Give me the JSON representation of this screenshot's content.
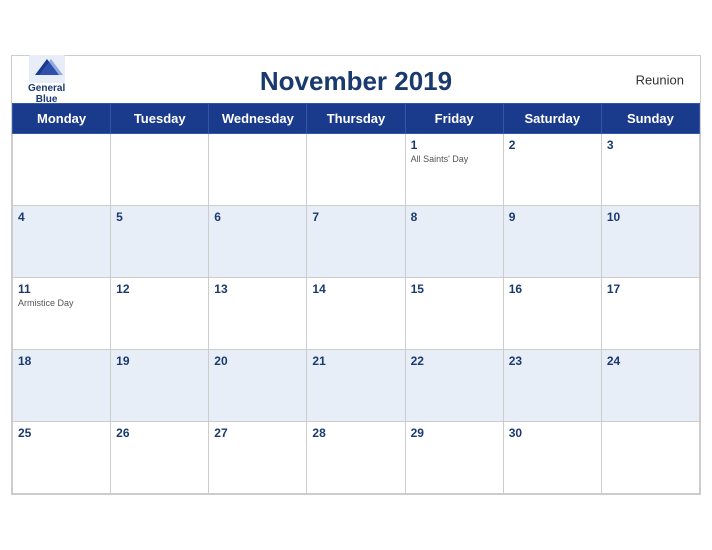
{
  "header": {
    "title": "November 2019",
    "region": "Reunion",
    "logo": {
      "line1": "General",
      "line2": "Blue"
    }
  },
  "weekdays": [
    "Monday",
    "Tuesday",
    "Wednesday",
    "Thursday",
    "Friday",
    "Saturday",
    "Sunday"
  ],
  "weeks": [
    [
      {
        "day": "",
        "holiday": ""
      },
      {
        "day": "",
        "holiday": ""
      },
      {
        "day": "",
        "holiday": ""
      },
      {
        "day": "",
        "holiday": ""
      },
      {
        "day": "1",
        "holiday": "All Saints' Day"
      },
      {
        "day": "2",
        "holiday": ""
      },
      {
        "day": "3",
        "holiday": ""
      }
    ],
    [
      {
        "day": "4",
        "holiday": ""
      },
      {
        "day": "5",
        "holiday": ""
      },
      {
        "day": "6",
        "holiday": ""
      },
      {
        "day": "7",
        "holiday": ""
      },
      {
        "day": "8",
        "holiday": ""
      },
      {
        "day": "9",
        "holiday": ""
      },
      {
        "day": "10",
        "holiday": ""
      }
    ],
    [
      {
        "day": "11",
        "holiday": "Armistice Day"
      },
      {
        "day": "12",
        "holiday": ""
      },
      {
        "day": "13",
        "holiday": ""
      },
      {
        "day": "14",
        "holiday": ""
      },
      {
        "day": "15",
        "holiday": ""
      },
      {
        "day": "16",
        "holiday": ""
      },
      {
        "day": "17",
        "holiday": ""
      }
    ],
    [
      {
        "day": "18",
        "holiday": ""
      },
      {
        "day": "19",
        "holiday": ""
      },
      {
        "day": "20",
        "holiday": ""
      },
      {
        "day": "21",
        "holiday": ""
      },
      {
        "day": "22",
        "holiday": ""
      },
      {
        "day": "23",
        "holiday": ""
      },
      {
        "day": "24",
        "holiday": ""
      }
    ],
    [
      {
        "day": "25",
        "holiday": ""
      },
      {
        "day": "26",
        "holiday": ""
      },
      {
        "day": "27",
        "holiday": ""
      },
      {
        "day": "28",
        "holiday": ""
      },
      {
        "day": "29",
        "holiday": ""
      },
      {
        "day": "30",
        "holiday": ""
      },
      {
        "day": "",
        "holiday": ""
      }
    ]
  ]
}
